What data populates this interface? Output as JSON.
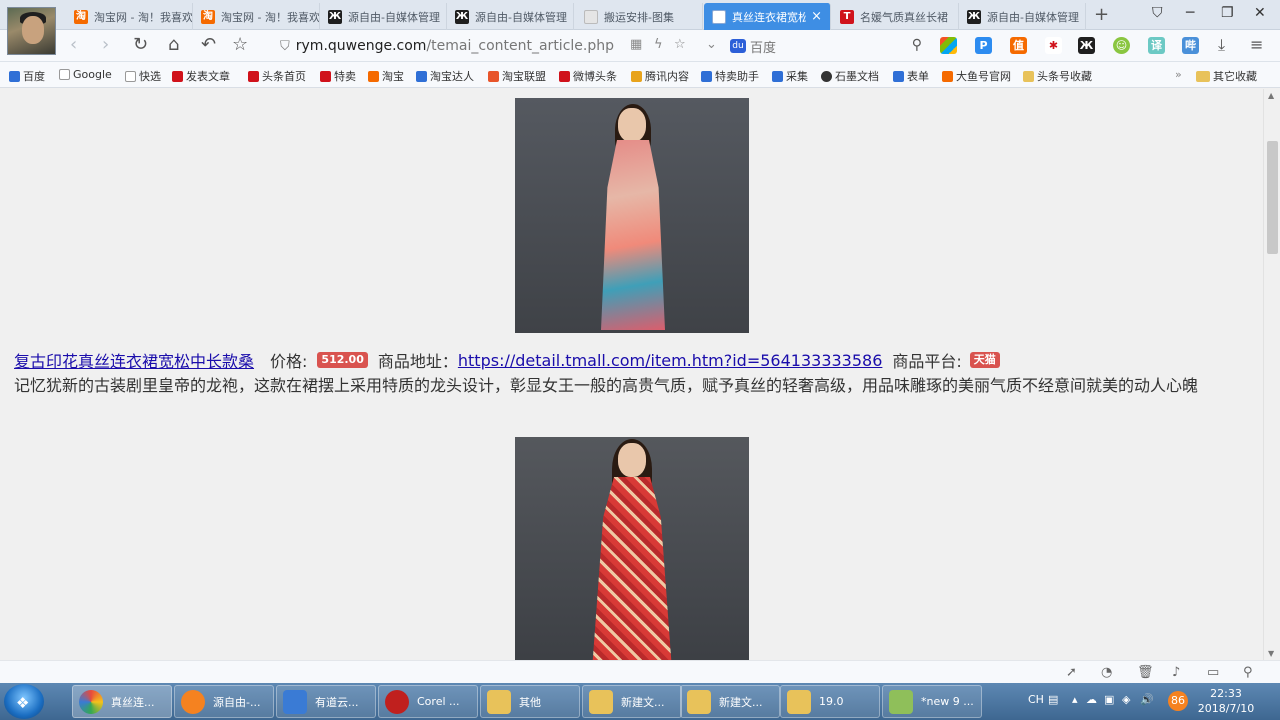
{
  "tabs": [
    {
      "title": "淘宝网 - 淘！我喜欢",
      "icon": "taobao-icon",
      "active": false
    },
    {
      "title": "淘宝网 - 淘！我喜欢",
      "icon": "taobao-icon",
      "active": false
    },
    {
      "title": "源自由-自媒体管理",
      "icon": "yuanziyou-icon",
      "active": false
    },
    {
      "title": "源自由-自媒体管理",
      "icon": "yuanziyou-icon",
      "active": false
    },
    {
      "title": "搬运安排-图集",
      "icon": "document-icon",
      "active": false
    },
    {
      "title": "真丝连衣裙宽松",
      "icon": "document-icon",
      "active": true
    },
    {
      "title": "名媛气质真丝长裙",
      "icon": "tmall-icon",
      "active": false
    },
    {
      "title": "源自由-自媒体管理",
      "icon": "yuanziyou-icon",
      "active": false
    }
  ],
  "tab_close_glyph": "×",
  "new_tab_glyph": "+",
  "address": {
    "host": "rym.quwenge.com",
    "path": "/temai_content_article.php"
  },
  "search": {
    "placeholder": "百度"
  },
  "bookmarks": [
    {
      "label": "百度",
      "color": "#2f6fd6"
    },
    {
      "label": "Google",
      "color": "#9a9a9a"
    },
    {
      "label": "快选",
      "color": "#9a9a9a"
    },
    {
      "label": "发表文章",
      "color": "#d0121b"
    },
    {
      "label": "头条首页",
      "color": "#d0121b"
    },
    {
      "label": "特卖",
      "color": "#d0121b"
    },
    {
      "label": "淘宝",
      "color": "#f56a00"
    },
    {
      "label": "淘宝达人",
      "color": "#2f6fd6"
    },
    {
      "label": "淘宝联盟",
      "color": "#e8552b"
    },
    {
      "label": "微博头条",
      "color": "#d0121b"
    },
    {
      "label": "腾讯内容",
      "color": "#e8a31b"
    },
    {
      "label": "特卖助手",
      "color": "#2f6fd6"
    },
    {
      "label": "采集",
      "color": "#2f6fd6"
    },
    {
      "label": "石墨文档",
      "color": "#333333"
    },
    {
      "label": "表单",
      "color": "#2f6fd6"
    },
    {
      "label": "大鱼号官网",
      "color": "#f56a00"
    },
    {
      "label": "头条号收藏",
      "color": "#e8c25a"
    }
  ],
  "bookmarks_more": "»",
  "bookmarks_other": "其它收藏",
  "product": {
    "title": "复古印花真丝连衣裙宽松中长款桑",
    "price_label": "价格:",
    "price": "512.00",
    "url_label": "商品地址：",
    "url": "https://detail.tmall.com/item.htm?id=564133333586",
    "platform_label": "商品平台:",
    "platform": "天猫",
    "description": "记忆犹新的古装剧里皇帝的龙袍，这款在裙摆上采用特质的龙头设计，彰显女王一般的高贵气质，赋予真丝的轻奢高级，用品味雕琢的美丽气质不经意间就美的动人心魄"
  },
  "taskbar": [
    {
      "label": "真丝连...",
      "color": "#e84a3c"
    },
    {
      "label": "源自由-...",
      "color": "#f58220"
    },
    {
      "label": "有道云...",
      "color": "#3a7bd5"
    },
    {
      "label": "Corel ...",
      "color": "#c0201e"
    },
    {
      "label": "其他",
      "color": "#e8c25a"
    },
    {
      "label": "新建文...",
      "color": "#e8c25a"
    },
    {
      "label": "新建文...",
      "color": "#e8c25a"
    },
    {
      "label": "19.0",
      "color": "#e8c25a"
    },
    {
      "label": "*new 9 ...",
      "color": "#8fbf5a"
    }
  ],
  "tray": {
    "lang": "CH",
    "battery": "86"
  },
  "clock": {
    "time": "22:33",
    "date": "2018/7/10"
  }
}
